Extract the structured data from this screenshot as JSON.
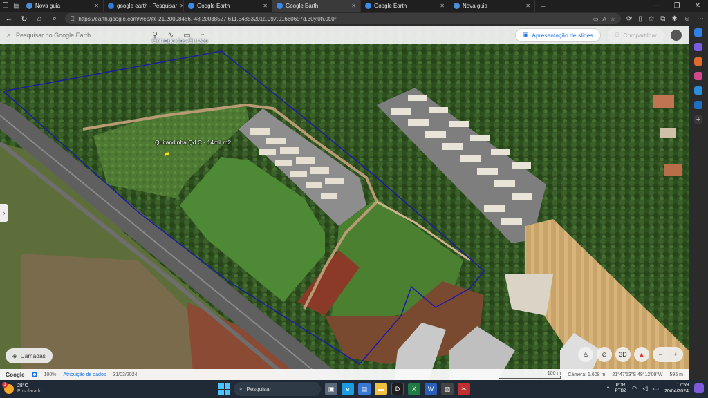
{
  "browser": {
    "tabs": [
      {
        "label": "Nova guia",
        "active": false,
        "color": "#4a90d9"
      },
      {
        "label": "google earth - Pesquisar",
        "active": false,
        "color": "#2f7bd6"
      },
      {
        "label": "Google Earth",
        "active": false,
        "color": "#3a8be8"
      },
      {
        "label": "Google Earth",
        "active": true,
        "color": "#3a8be8"
      },
      {
        "label": "Google Earth",
        "active": false,
        "color": "#3a8be8"
      },
      {
        "label": "Nova guia",
        "active": false,
        "color": "#4a90d9"
      }
    ],
    "url": "https://earth.google.com/web/@-21.20008456,-48.20038527,611.54853201a,997.01660697d,30y,0h,0t,0r"
  },
  "earth": {
    "search_placeholder": "Pesquisar no Google Earth",
    "stream_label": "Córrego das Cruzes",
    "slides_button": "Apresentação de slides",
    "share_button": "Compartilhar",
    "placemark_label": "Quitandinha Qd C - 14mil m2",
    "layers_button": "Camadas",
    "view_3d": "3D",
    "status": {
      "brand": "Google",
      "zoom": "100%",
      "attribution": "Atribuição de dados",
      "date": "31/03/2024",
      "scale": "100 m",
      "camera": "Câmera: 1.608 m",
      "coords": "21°47'53\"S 48°12'09\"W",
      "elevation": "595 m"
    }
  },
  "taskbar": {
    "notif_count": "1",
    "temp": "28°C",
    "weather_desc": "Ensolarado",
    "search_placeholder": "Pesquisar",
    "lang_top": "POR",
    "lang_bottom": "PTB2",
    "time": "17:59",
    "date": "20/04/2024"
  }
}
